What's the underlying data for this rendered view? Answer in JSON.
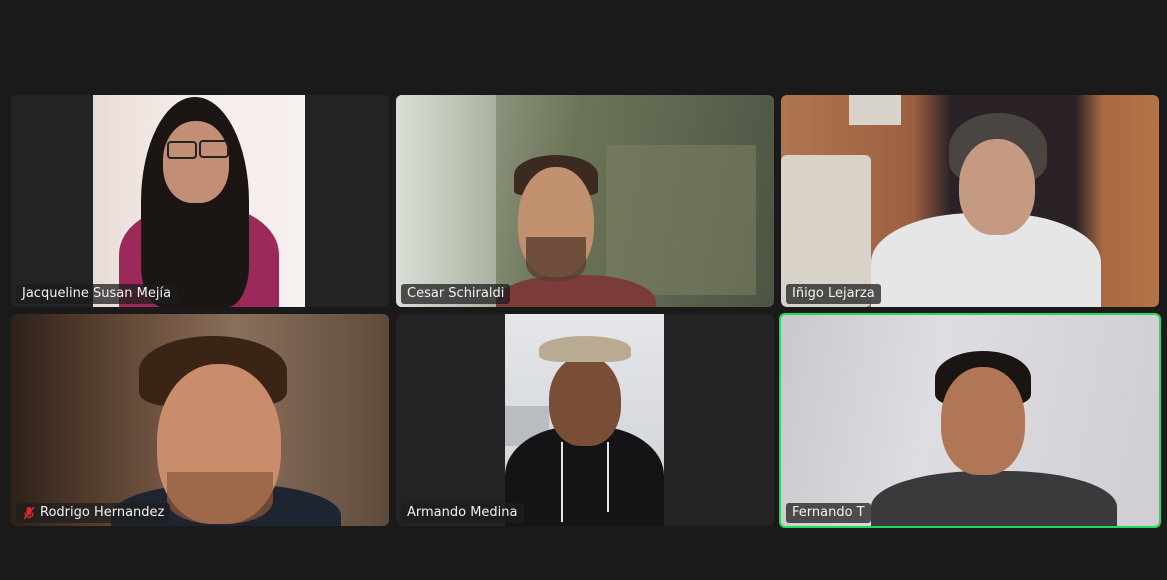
{
  "meeting": {
    "participants": [
      {
        "name": "Jacqueline Susan Mejía",
        "muted": false,
        "active_speaker": false
      },
      {
        "name": "Cesar Schiraldi",
        "muted": false,
        "active_speaker": false
      },
      {
        "name": "Iñigo Lejarza",
        "muted": false,
        "active_speaker": false
      },
      {
        "name": "Rodrigo Hernandez",
        "muted": true,
        "active_speaker": false
      },
      {
        "name": "Armando Medina",
        "muted": false,
        "active_speaker": false
      },
      {
        "name": "Fernando T",
        "muted": false,
        "active_speaker": true
      }
    ]
  },
  "icons": {
    "muted": "microphone-muted-icon"
  },
  "colors": {
    "background": "#1a1a1a",
    "tile": "#232323",
    "active_speaker_border": "#23d959",
    "mute_icon": "#e02828"
  }
}
